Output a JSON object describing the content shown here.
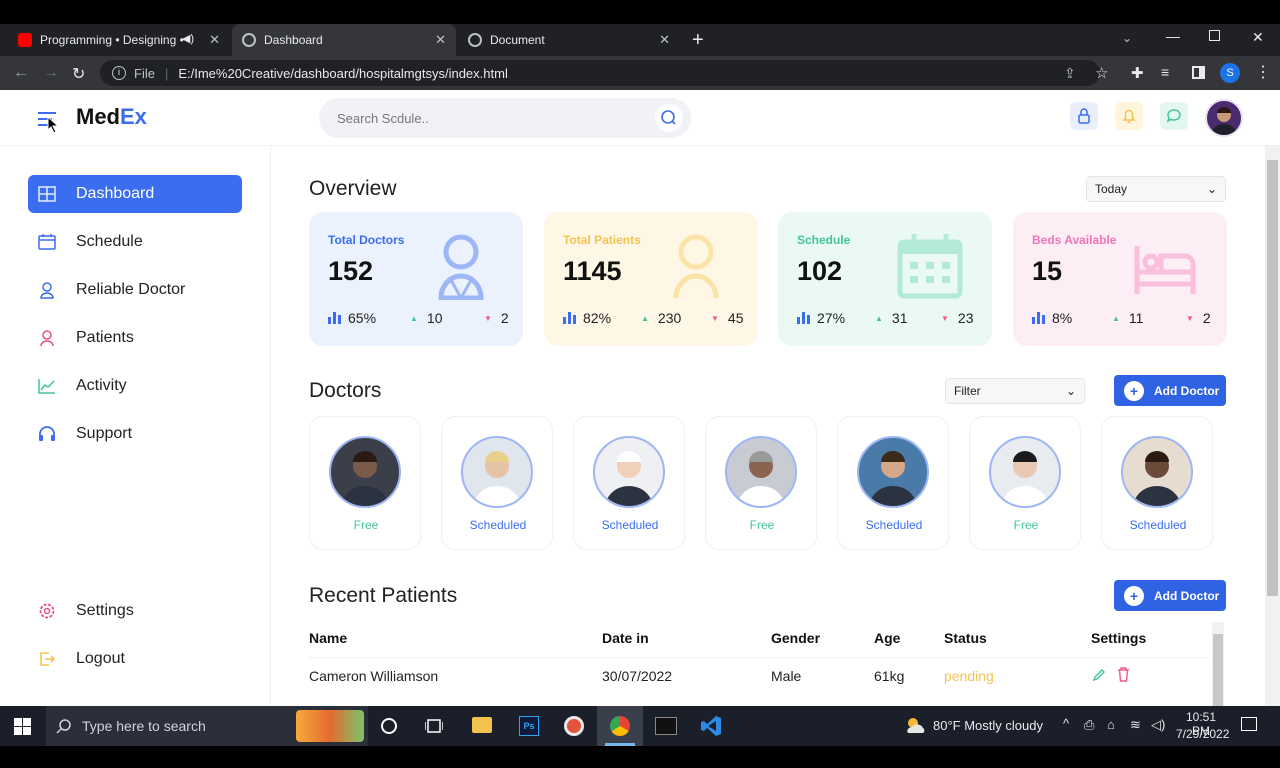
{
  "browser": {
    "tabs": [
      {
        "label": "Programming • Designing • ",
        "active": false
      },
      {
        "label": "Dashboard",
        "active": true
      },
      {
        "label": "Document",
        "active": false
      }
    ],
    "new_tab": "+",
    "file_label": "File",
    "url": "E:/Ime%20Creative/dashboard/hospitalmgtsys/index.html",
    "profile_initial": "S"
  },
  "app": {
    "logo_part1": "Med",
    "logo_part2": "Ex",
    "search_placeholder": "Search Scdule..",
    "sidebar": {
      "items": [
        {
          "label": "Dashboard",
          "icon": "grid-icon"
        },
        {
          "label": "Schedule",
          "icon": "calendar-icon"
        },
        {
          "label": "Reliable Doctor",
          "icon": "doctor-icon"
        },
        {
          "label": "Patients",
          "icon": "patient-icon"
        },
        {
          "label": "Activity",
          "icon": "chart-line-icon"
        },
        {
          "label": "Support",
          "icon": "headset-icon"
        }
      ],
      "bottom": [
        {
          "label": "Settings",
          "icon": "gear-icon"
        },
        {
          "label": "Logout",
          "icon": "logout-icon"
        }
      ]
    },
    "overview": {
      "title": "Overview",
      "period": "Today",
      "cards": [
        {
          "label": "Total Doctors",
          "value": "152",
          "pct": "65%",
          "up": "10",
          "down": "2",
          "accent": "#3b6df0",
          "bg": "#ecf1fe",
          "icon": "doctor-icon"
        },
        {
          "label": "Total Patients",
          "value": "1145",
          "pct": "82%",
          "up": "230",
          "down": "45",
          "accent": "#f4c451",
          "bg": "#fff7e6",
          "icon": "patient-icon"
        },
        {
          "label": "Schedule",
          "value": "102",
          "pct": "27%",
          "up": "31",
          "down": "23",
          "accent": "#44c49a",
          "bg": "#eafaf3",
          "icon": "calendar-icon"
        },
        {
          "label": "Beds Available",
          "value": "15",
          "pct": "8%",
          "up": "11",
          "down": "2",
          "accent": "#f076b8",
          "bg": "#fdeef6",
          "icon": "bed-icon"
        }
      ]
    },
    "doctors": {
      "title": "Doctors",
      "filter": "Filter",
      "add_label": "Add Doctor",
      "list": [
        {
          "status": "Free"
        },
        {
          "status": "Scheduled"
        },
        {
          "status": "Scheduled"
        },
        {
          "status": "Free"
        },
        {
          "status": "Scheduled"
        },
        {
          "status": "Free"
        },
        {
          "status": "Scheduled"
        }
      ]
    },
    "patients": {
      "title": "Recent Patients",
      "add_label": "Add Doctor",
      "columns": [
        "Name",
        "Date in",
        "Gender",
        "Age",
        "Status",
        "Settings"
      ],
      "rows": [
        {
          "name": "Cameron Williamson",
          "date": "30/07/2022",
          "gender": "Male",
          "age": "61kg",
          "status": "pending"
        }
      ]
    }
  },
  "taskbar": {
    "search_placeholder": "Type here to search",
    "weather": "80°F  Mostly cloudy",
    "time": "10:51 PM",
    "date": "7/29/2022"
  },
  "colors": {
    "free": "#44c49a",
    "scheduled": "#3b6df0",
    "pending": "#f4c451",
    "primary": "#2f63e3"
  }
}
